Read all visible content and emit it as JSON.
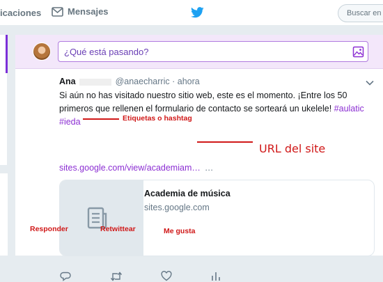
{
  "nav": {
    "notifications_label": "icaciones",
    "messages_label": "Mensajes",
    "search_placeholder": "Buscar en"
  },
  "composer": {
    "placeholder": "¿Qué está pasando?"
  },
  "tweet": {
    "name": "Ana",
    "handle": "@anaecharric",
    "separator": "·",
    "time": "ahora",
    "text_line1": "Si aún no has visitado nuestro sitio web, este es el momento. ¡Entre los 50",
    "text_line2": "primeros que rellenen el formulario de contacto se sorteará un   ukelele!",
    "hashtag1": "#aulatic",
    "hashtag2": "#ieda",
    "link": "sites.google.com/view/academiam…",
    "link_trailing": "…",
    "card": {
      "title": "Academia de música",
      "domain": "sites.google.com"
    }
  },
  "annotations": {
    "hashtags": "Etiquetas o hashtag",
    "url": "URL del site",
    "reply": "Responder",
    "retweet": "Retwittear",
    "like": "Me gusta"
  },
  "colors": {
    "accent": "#7b2fd8",
    "hashtag": "#8c2fd3",
    "annotation": "#d01818",
    "twitter_blue": "#1da1f2"
  }
}
